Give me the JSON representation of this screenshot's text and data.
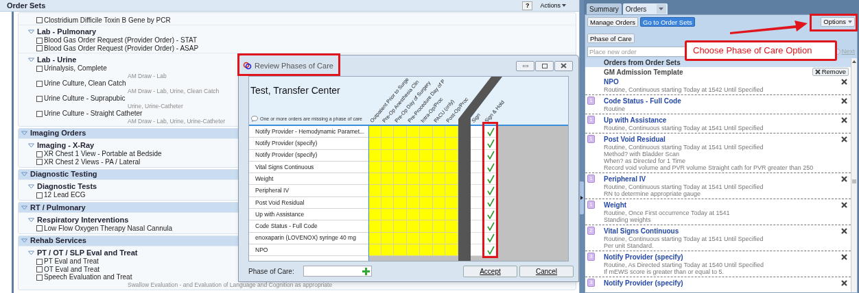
{
  "order_sets": {
    "title": "Order Sets",
    "help": "?",
    "actions": "Actions",
    "sections": [
      {
        "groups": [
          {
            "items": [
              {
                "label": "Clostridium Difficile Toxin B Gene by PCR",
                "checked": false
              }
            ]
          },
          {
            "title": "Lab - Pulmonary",
            "expanded": true,
            "items": [
              {
                "label": "Blood Gas Order Request (Provider Order) - STAT",
                "checked": false
              },
              {
                "label": "Blood Gas Order Request (Provider Order) - ASAP",
                "checked": false
              }
            ]
          },
          {
            "title": "Lab - Urine",
            "expanded": true,
            "items": [
              {
                "label": "Urinalysis, Complete",
                "checked": false,
                "detail": "AM Draw - Lab"
              },
              {
                "label": "Urine Culture, Clean Catch",
                "checked": false,
                "detail": "AM Draw - Lab, Urine, Clean Catch"
              },
              {
                "label": "Urine Culture - Suprapubic",
                "checked": false,
                "detail": "Urine, Urine-Catheter"
              },
              {
                "label": "Urine Culture - Straight Catheter",
                "checked": false,
                "detail": "AM Draw - Lab, Urine, Urine-Catheter"
              }
            ]
          }
        ]
      },
      {
        "title": "Imaging Orders",
        "expanded": true,
        "groups": [
          {
            "title": "Imaging - X-Ray",
            "expanded": true,
            "items": [
              {
                "label": "XR Chest 1 View - Portable at Bedside",
                "checked": false
              },
              {
                "label": "XR Chest 2 Views - PA / Lateral",
                "checked": false
              }
            ]
          }
        ]
      },
      {
        "title": "Diagnostic Testing",
        "expanded": true,
        "groups": [
          {
            "title": "Diagnostic Tests",
            "expanded": true,
            "items": [
              {
                "label": "12 Lead ECG",
                "checked": false
              }
            ]
          }
        ]
      },
      {
        "title": "RT / Pulmonary",
        "expanded": true,
        "groups": [
          {
            "title": "Respiratory Interventions",
            "expanded": true,
            "items": [
              {
                "label": "Low Flow Oxygen Therapy Nasal Cannula",
                "checked": false
              }
            ]
          }
        ]
      },
      {
        "title": "Rehab Services",
        "expanded": true,
        "groups": [
          {
            "title": "PT / OT / SLP Eval and Treat",
            "expanded": true,
            "items": [
              {
                "label": "PT Eval and Treat",
                "checked": false
              },
              {
                "label": "OT Eval and Treat",
                "checked": false
              },
              {
                "label": "Speech Evaluation and Treat",
                "checked": false,
                "detail": "Swallow Evaluation - and Evaluation of Language and Cognition as appropriate"
              }
            ]
          }
        ]
      }
    ]
  },
  "dialog": {
    "title": "Review Phases of Care",
    "patient": "Test, Transfer Center",
    "warning": "One or more orders are missing a phase of care",
    "phase_columns": [
      "Outpatient Prior to Surge",
      "Pre-Op Anesthesia Clin",
      "Pre-Op Day of Surgery",
      "Pre-Procedure Day of P",
      "Intra-Op/Proc",
      "PACU (only)",
      "Post-Op/Proc"
    ],
    "sign_column": "Sign",
    "sign_hold_column": "Sign & Hold",
    "orders": [
      {
        "name": "Notify Provider - Hemodynamic Paramet...",
        "sign_hold": true
      },
      {
        "name": "Notify Provider (specify)",
        "sign_hold": true
      },
      {
        "name": "Notify Provider (specify)",
        "sign_hold": true
      },
      {
        "name": "Vital Signs Continuous",
        "sign_hold": true
      },
      {
        "name": "Weight",
        "sign_hold": true
      },
      {
        "name": "Peripheral IV",
        "sign_hold": true
      },
      {
        "name": "Post Void Residual",
        "sign_hold": true
      },
      {
        "name": "Up with Assistance",
        "sign_hold": true
      },
      {
        "name": "Code Status - Full Code",
        "sign_hold": true
      },
      {
        "name": "enoxaparin (LOVENOX) syringe 40 mg",
        "sign_hold": true
      },
      {
        "name": "NPO",
        "sign_hold": true
      }
    ],
    "phase_label": "Phase of Care:",
    "accept": "Accept",
    "cancel": "Cancel"
  },
  "orders_panel": {
    "tabs": [
      {
        "label": "Summary",
        "selected": false
      },
      {
        "label": "Orders",
        "selected": true
      }
    ],
    "manage_orders": "Manage Orders",
    "go_to_order_sets": "Go to Order Sets",
    "options": "Options",
    "phase_of_care": "Phase of Care",
    "search": {
      "placeholder": "Place new order"
    },
    "next": "Next",
    "list_header": "Orders from Order Sets",
    "template": "GM Admission Template",
    "remove": "Remove",
    "orders": [
      {
        "name": "NPO",
        "details": [
          "Routine, Continuous starting Today at 1542 Until Specified"
        ]
      },
      {
        "badge": "1",
        "name": "Code Status - Full Code",
        "details": [
          "Routine"
        ]
      },
      {
        "badge": "1",
        "name": "Up with Assistance",
        "details": [
          "Routine, Continuous starting Today at 1541 Until Specified"
        ]
      },
      {
        "badge": "1",
        "name": "Post Void Residual",
        "details": [
          "Routine, Continuous starting Today at 1541 Until Specified",
          "Method? with Bladder Scan",
          "When? as Directed for 1 Time",
          "Record void volume and PVR volume Straight cath for PVR greater than 250"
        ]
      },
      {
        "badge": "1",
        "name": "Peripheral IV",
        "details": [
          "Routine, Continuous starting Today at 1541 Until Specified",
          "RN to determine appropriate gauge"
        ]
      },
      {
        "badge": "1",
        "name": "Weight",
        "details": [
          "Routine, Once First occurrence Today at 1541",
          "Standing weights"
        ]
      },
      {
        "badge": "2",
        "name": "Vital Signs Continuous",
        "details": [
          "Routine, Continuous starting Today at 1541 Until Specified",
          "Per unit Standard."
        ]
      },
      {
        "badge": "3",
        "name": "Notify Provider (specify)",
        "details": [
          "Routine, As Directed starting Today at 1540 Until Specified",
          "If mEWS score is greater than or equal to 5."
        ]
      },
      {
        "badge": "3",
        "name": "Notify Provider (specify)"
      }
    ]
  },
  "callout": "Choose Phase of Care Option"
}
